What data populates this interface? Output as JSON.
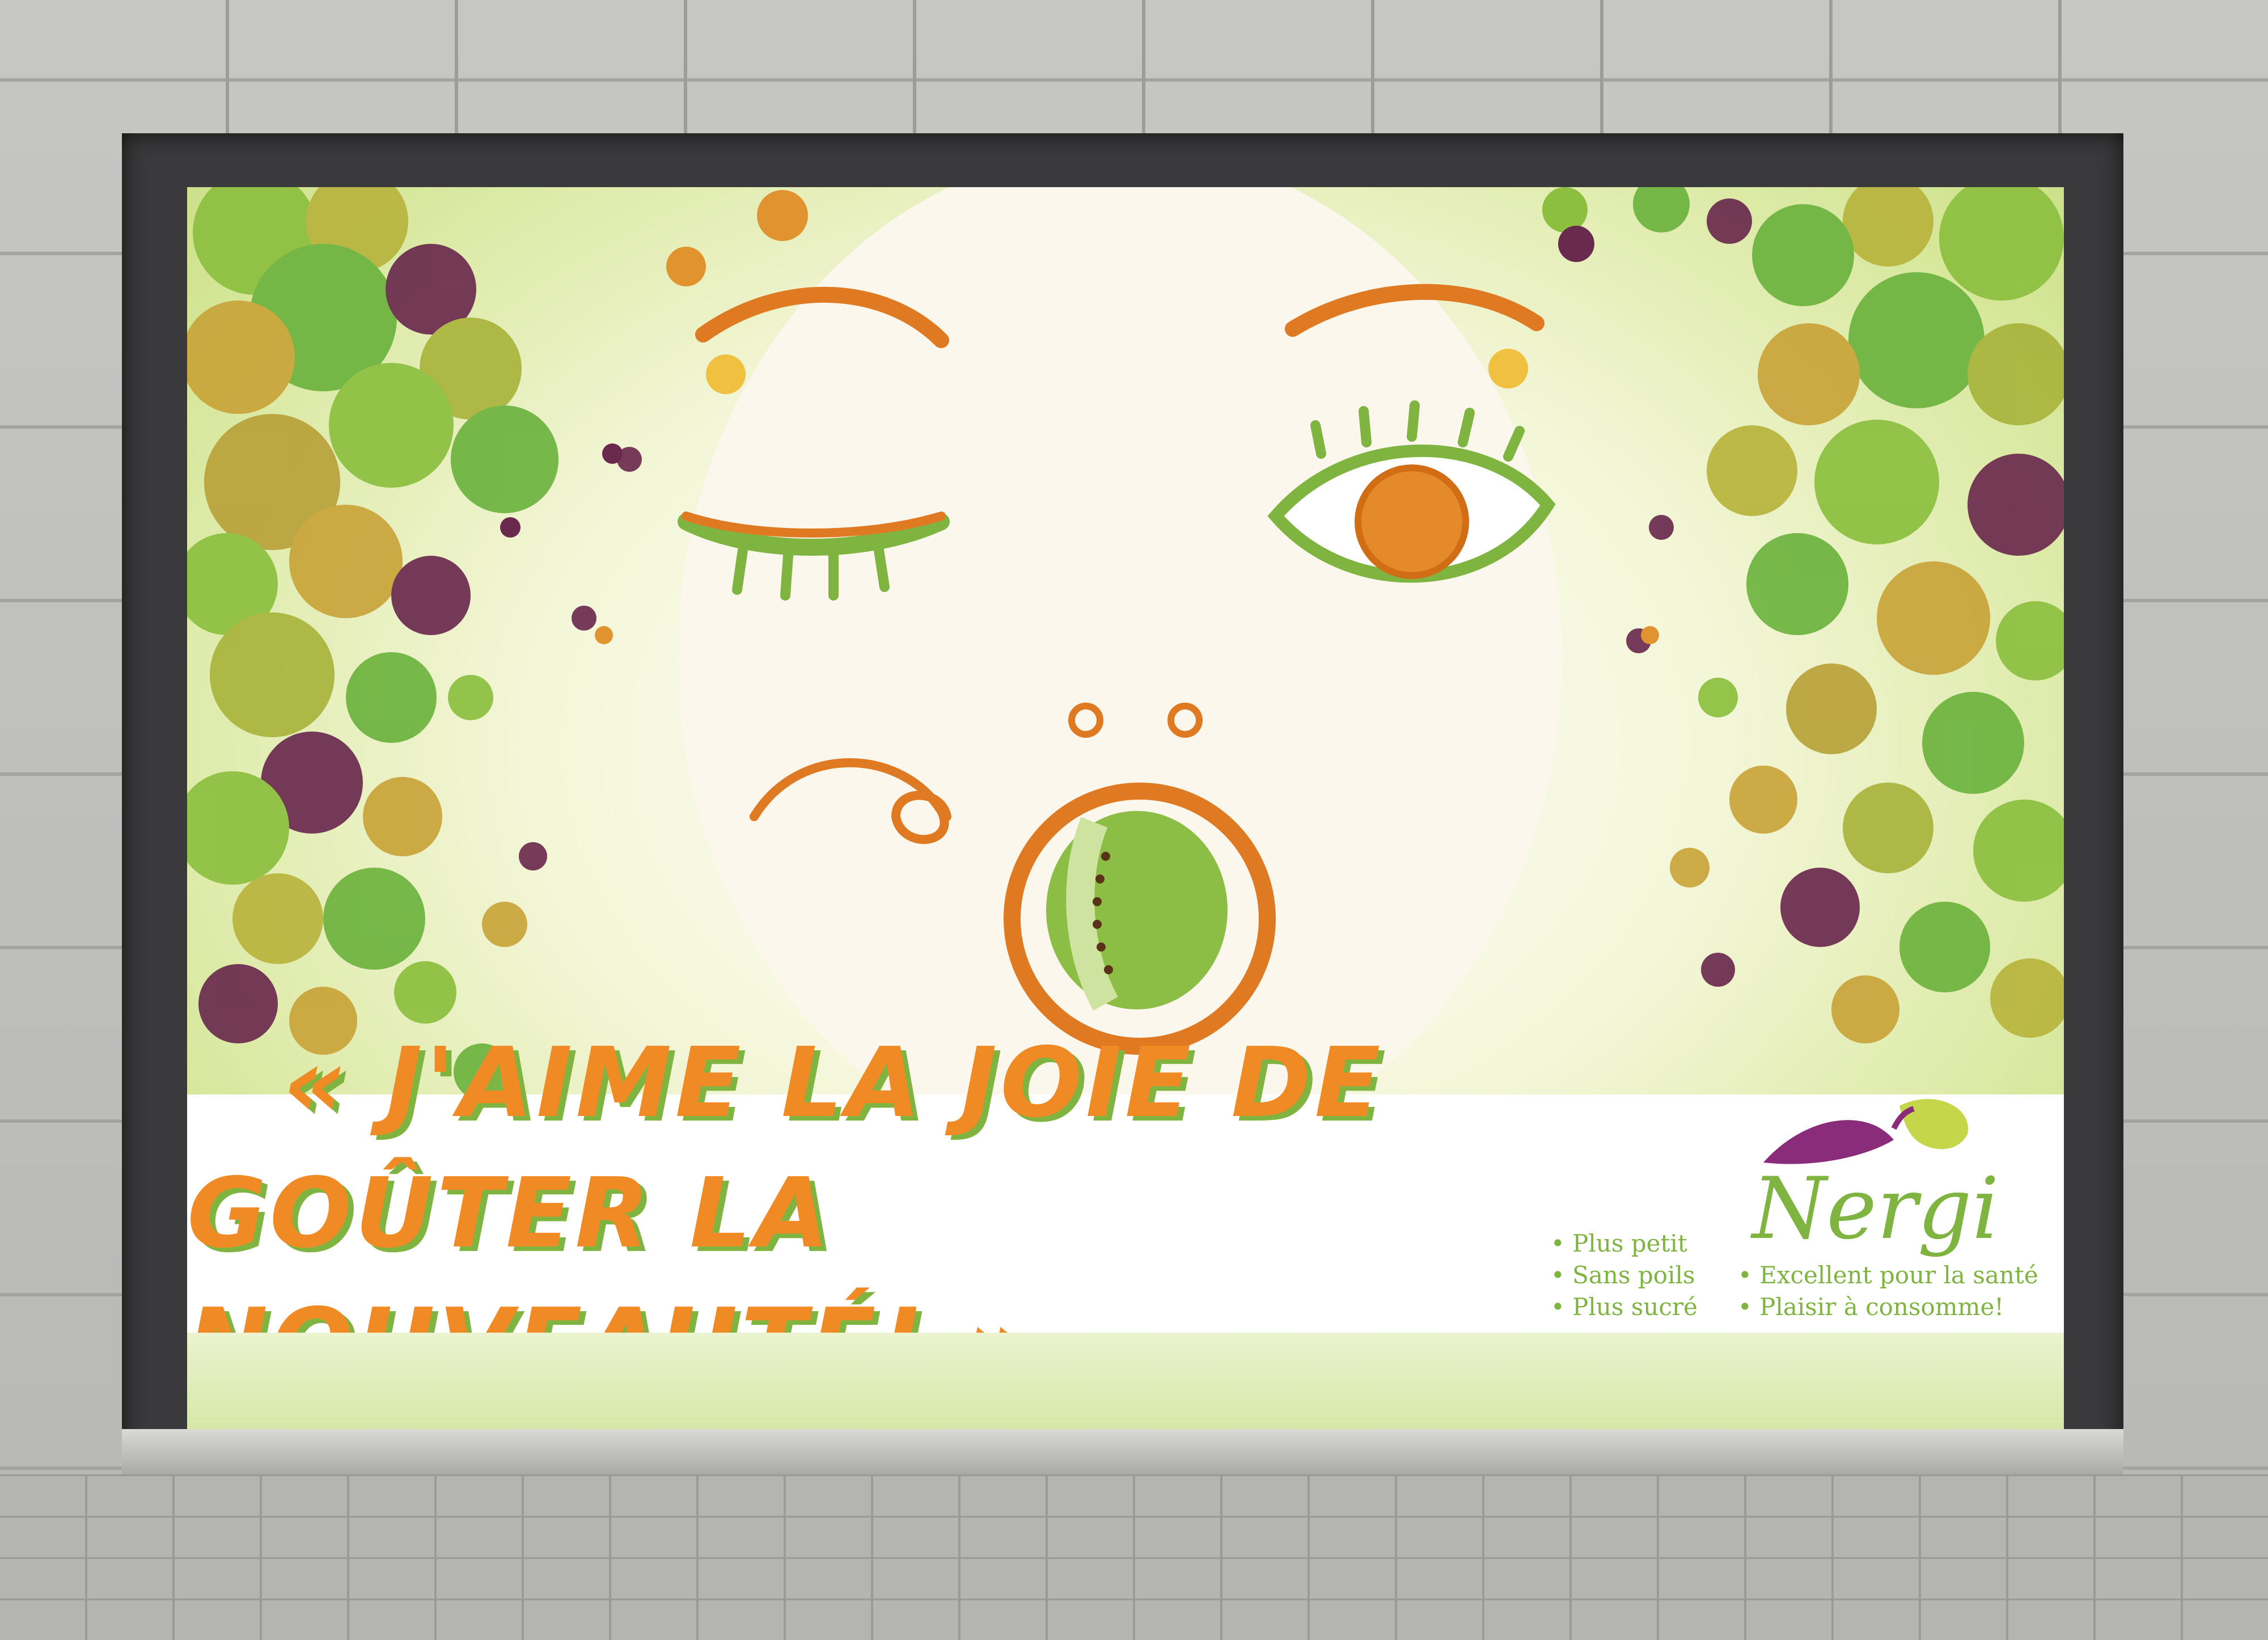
{
  "slogan": {
    "line1": "« J'AIME LA JOIE DE",
    "line2": "GOÛTER LA NOUVEAUTÉ! »"
  },
  "brand": {
    "name": "Nergi"
  },
  "features": {
    "left": [
      "• Plus petit",
      "• Sans poils",
      "• Plus sucré"
    ],
    "right": [
      "• Excellent pour la santé",
      "• Plaisir à consomme!"
    ]
  },
  "colors": {
    "orange": "#f08a24",
    "green": "#7fb441",
    "purple": "#6a2a4e",
    "olive": "#b8b43e"
  }
}
